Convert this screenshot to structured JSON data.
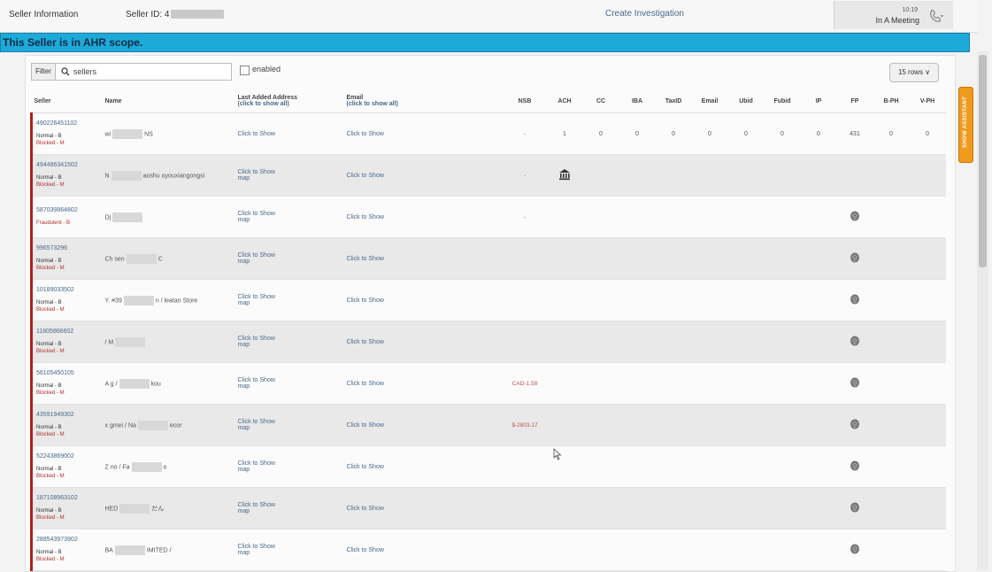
{
  "topbar": {
    "title": "Seller Information",
    "seller_id_label": "Seller ID: 4",
    "create_investigation": "Create Investigation",
    "time": "10:19",
    "status": "In A Meeting"
  },
  "banner": {
    "text": "This Seller is in AHR scope."
  },
  "filter": {
    "label": "Filter",
    "placeholder": "sellers",
    "enabled_label": "enabled"
  },
  "rows_select": {
    "value": "15 rows"
  },
  "assistant_tab": {
    "label": "SHOW ASSISTANT"
  },
  "columns": {
    "seller": "Seller",
    "name": "Name",
    "address_title": "Last Added Address",
    "address_sub": "(click to show all)",
    "email_title": "Email",
    "email_sub": "(click to show all)",
    "nsb": "NSB",
    "ach": "ACH",
    "cc": "CC",
    "iba": "IBA",
    "taxid": "TaxID",
    "email2": "Email",
    "ubid": "Ubid",
    "fubid": "Fubid",
    "ip": "IP",
    "fp": "FP",
    "bph": "B-PH",
    "vph": "V-PH"
  },
  "rows": [
    {
      "id": "490226451102",
      "status1": "Normal - B",
      "status2": "Blocked - M",
      "name_a": "wi",
      "name_b": "NS",
      "address": "Click to Show",
      "map": "",
      "email": "Click to Show",
      "nsb": "-",
      "ach": "1",
      "cc": "0",
      "iba": "0",
      "taxid": "0",
      "email2": "0",
      "ubid": "0",
      "fubid": "0",
      "ip": "0",
      "fp": "431",
      "bph": "0",
      "vph": "0"
    },
    {
      "id": "494486341502",
      "status1": "Normal - B",
      "status2": "Blocked - M",
      "name_a": "N",
      "name_b": "aoshu oyouxiangongsi",
      "address": "Click to Show",
      "map": "map",
      "email": "Click to Show",
      "nsb": "-"
    },
    {
      "id": "587039864802",
      "status1": "Fraudulent - B",
      "status2": "",
      "name_a": "Dj",
      "name_b": "",
      "address": "Click to Show",
      "map": "map",
      "email": "Click to Show",
      "nsb": "-"
    },
    {
      "id": "996573296",
      "status1": "Normal - B",
      "status2": "Blocked - M",
      "name_a": "Ch sen",
      "name_b": "C",
      "address": "Click to Show",
      "map": "map",
      "email": "Click to Show",
      "nsb": ""
    },
    {
      "id": "10189033502",
      "status1": "Normal - B",
      "status2": "Blocked - M",
      "name_a": "Y. #39",
      "name_b": "n / leatan Store",
      "address": "Click to Show",
      "map": "map",
      "email": "Click to Show",
      "nsb": ""
    },
    {
      "id": "11805866602",
      "status1": "Normal - B",
      "status2": "Blocked - M",
      "name_a": "/ M",
      "name_b": "",
      "address": "Click to Show",
      "map": "map",
      "email": "Click to Show",
      "nsb": ""
    },
    {
      "id": "56105450105",
      "status1": "Normal - B",
      "status2": "Blocked - M",
      "name_a": "A g /",
      "name_b": "kou",
      "address": "Click to Show",
      "map": "map",
      "email": "Click to Show",
      "nsb": "CAD-1.58"
    },
    {
      "id": "43591949302",
      "status1": "Normal - B",
      "status2": "Blocked - M",
      "name_a": "x gmei / Na",
      "name_b": "ecor",
      "address": "Click to Show",
      "map": "map",
      "email": "Click to Show",
      "nsb": "$-2803.17"
    },
    {
      "id": "52243869002",
      "status1": "Normal - B",
      "status2": "Blocked - M",
      "name_a": "Z no / Fa",
      "name_b": "o",
      "address": "Click to Show",
      "map": "map",
      "email": "Click to Show",
      "nsb": ""
    },
    {
      "id": "187108963102",
      "status1": "Normal - B",
      "status2": "Blocked - M",
      "name_a": "HED",
      "name_b": "だん",
      "address": "Click to Show",
      "map": "map",
      "email": "Click to Show",
      "nsb": ""
    },
    {
      "id": "288543973902",
      "status1": "Normal - B",
      "status2": "Blocked - M",
      "name_a": "BA",
      "name_b": "IMITED /",
      "address": "Click to Show",
      "map": "map",
      "email": "Click to Show",
      "nsb": ""
    }
  ],
  "icons": {
    "fingerprint": "fingerprint-icon",
    "bank": "bank-icon",
    "search": "search-icon",
    "phone": "phone-icon"
  },
  "colors": {
    "banner": "#1eaad9",
    "assistant": "#f09a1c",
    "seller_bar": "#b01e1e"
  }
}
